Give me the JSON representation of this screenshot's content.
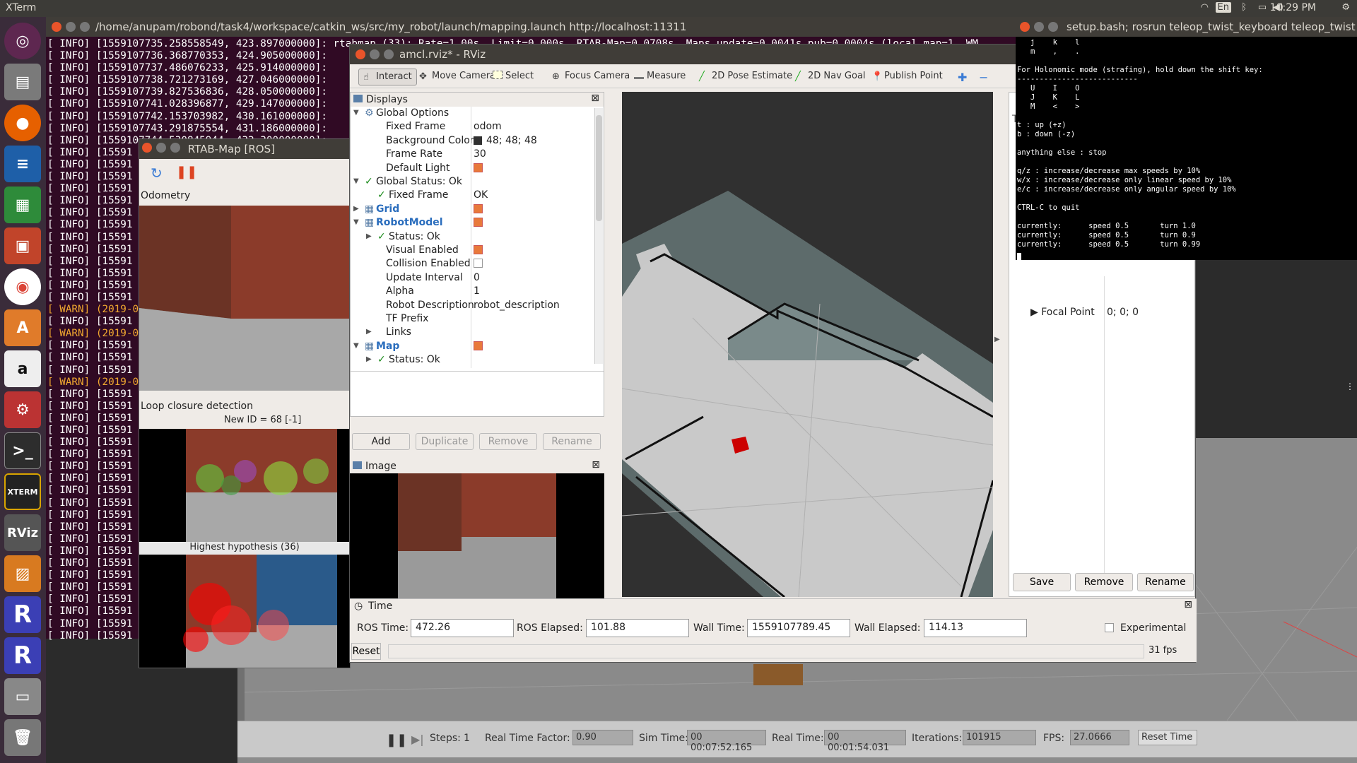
{
  "topbar": {
    "app_title": "XTerm",
    "time": "10:29 PM",
    "language": "En"
  },
  "launcher": {
    "items": [
      "ubuntu-icon",
      "files-icon",
      "firefox-icon",
      "writer-icon",
      "calc-icon",
      "impress-icon",
      "chrome-icon",
      "software-center-icon",
      "amazon-icon",
      "settings-icon",
      "terminal-icon",
      "xterm-icon",
      "rviz-icon",
      "virtualbox-icon",
      "rstudio-icon",
      "rstudio-icon-2",
      "disk-icon",
      "trash-icon"
    ]
  },
  "xterm_main": {
    "title": "/home/anupam/robond/task4/workspace/catkin_ws/src/my_robot/launch/mapping.launch http://localhost:11311",
    "lines": [
      {
        "text": "[ INFO] [1559107735.258558549, 423.897000000]: rtabmap (33): Rate=1.00s, Limit=0.000s, RTAB-Map=0.0708s, Maps update=0.0041s pub=0.0004s (local map=1, WM",
        "warn": false
      },
      {
        "text": "[ INFO] [1559107736.368770353, 424.905000000]:",
        "warn": false
      },
      {
        "text": "[ INFO] [1559107737.486076233, 425.914000000]:",
        "warn": false
      },
      {
        "text": "[ INFO] [1559107738.721273169, 427.046000000]:",
        "warn": false
      },
      {
        "text": "[ INFO] [1559107739.827536836, 428.050000000]:",
        "warn": false
      },
      {
        "text": "[ INFO] [1559107741.028396877, 429.147000000]:",
        "warn": false
      },
      {
        "text": "[ INFO] [1559107742.153703982, 430.161000000]:",
        "warn": false
      },
      {
        "text": "[ INFO] [1559107743.291875554, 431.186000000]:",
        "warn": false
      },
      {
        "text": "[ INFO] [1559107744.530845944, 432.300000000]:",
        "warn": false
      },
      {
        "text": "[ INFO] [15591",
        "warn": false
      },
      {
        "text": "[ INFO] [15591",
        "warn": false
      },
      {
        "text": "[ INFO] [15591",
        "warn": false
      },
      {
        "text": "[ INFO] [15591",
        "warn": false
      },
      {
        "text": "[ INFO] [15591",
        "warn": false
      },
      {
        "text": "[ INFO] [15591",
        "warn": false
      },
      {
        "text": "[ INFO] [15591",
        "warn": false
      },
      {
        "text": "[ INFO] [15591",
        "warn": false
      },
      {
        "text": "[ INFO] [15591",
        "warn": false
      },
      {
        "text": "[ INFO] [15591",
        "warn": false
      },
      {
        "text": "[ INFO] [15591",
        "warn": false
      },
      {
        "text": "[ INFO] [15591",
        "warn": false
      },
      {
        "text": "[ INFO] [15591",
        "warn": false
      },
      {
        "text": "[ WARN] (2019-0",
        "warn": true
      },
      {
        "text": "[ INFO] [15591",
        "warn": false
      },
      {
        "text": "[ WARN] (2019-0",
        "warn": true
      },
      {
        "text": "[ INFO] [15591",
        "warn": false
      },
      {
        "text": "[ INFO] [15591",
        "warn": false
      },
      {
        "text": "[ INFO] [15591",
        "warn": false
      },
      {
        "text": "[ WARN] (2019-0",
        "warn": true
      },
      {
        "text": "[ INFO] [15591",
        "warn": false
      },
      {
        "text": "[ INFO] [15591",
        "warn": false
      },
      {
        "text": "[ INFO] [15591",
        "warn": false
      },
      {
        "text": "[ INFO] [15591",
        "warn": false
      },
      {
        "text": "[ INFO] [15591",
        "warn": false
      },
      {
        "text": "[ INFO] [15591",
        "warn": false
      },
      {
        "text": "[ INFO] [15591",
        "warn": false
      },
      {
        "text": "[ INFO] [15591",
        "warn": false
      },
      {
        "text": "[ INFO] [15591",
        "warn": false
      },
      {
        "text": "[ INFO] [15591",
        "warn": false
      },
      {
        "text": "[ INFO] [15591",
        "warn": false
      },
      {
        "text": "[ INFO] [15591",
        "warn": false
      },
      {
        "text": "[ INFO] [15591",
        "warn": false
      },
      {
        "text": "[ INFO] [15591",
        "warn": false
      },
      {
        "text": "[ INFO] [15591",
        "warn": false
      },
      {
        "text": "[ INFO] [15591",
        "warn": false
      },
      {
        "text": "[ INFO] [15591",
        "warn": false
      },
      {
        "text": "[ INFO] [15591",
        "warn": false
      },
      {
        "text": "[ INFO] [15591",
        "warn": false
      },
      {
        "text": "[ INFO] [15591",
        "warn": false
      },
      {
        "text": "[ INFO] [15591",
        "warn": false
      }
    ]
  },
  "rtabmap": {
    "title": "RTAB-Map [ROS]",
    "odometry_label": "Odometry",
    "loop_label": "Loop closure detection",
    "new_id": "New ID = 68 [-1]",
    "hypothesis": "Highest hypothesis (36)"
  },
  "rviz": {
    "title": "amcl.rviz* - RViz",
    "tools": [
      "Interact",
      "Move Camera",
      "Select",
      "Focus Camera",
      "Measure",
      "2D Pose Estimate",
      "2D Nav Goal",
      "Publish Point"
    ],
    "displays_header": "Displays",
    "image_header": "Image",
    "time_header": "Time",
    "buttons": {
      "add": "Add",
      "duplicate": "Duplicate",
      "remove": "Remove",
      "rename": "Rename"
    },
    "views_buttons": {
      "save": "Save",
      "remove": "Remove",
      "rename": "Rename"
    },
    "views_partial": "Ty",
    "focal_point_label": "Focal Point",
    "focal_point_value": "0; 0; 0"
  },
  "tree": [
    {
      "name": "Global Options",
      "value": "",
      "indent": 0,
      "arrow": "▼",
      "kind": "globe",
      "check": null
    },
    {
      "name": "Fixed Frame",
      "value": "odom",
      "indent": 1,
      "arrow": "",
      "kind": "",
      "check": null
    },
    {
      "name": "Background Color",
      "value": "48; 48; 48",
      "indent": 1,
      "arrow": "",
      "kind": "",
      "check": null,
      "swatch": true
    },
    {
      "name": "Frame Rate",
      "value": "30",
      "indent": 1,
      "arrow": "",
      "kind": "",
      "check": null
    },
    {
      "name": "Default Light",
      "value": "",
      "indent": 1,
      "arrow": "",
      "kind": "",
      "check": true
    },
    {
      "name": "Global Status: Ok",
      "value": "",
      "indent": 0,
      "arrow": "▼",
      "kind": "ok",
      "check": null
    },
    {
      "name": "Fixed Frame",
      "value": "OK",
      "indent": 1,
      "arrow": "",
      "kind": "ok",
      "check": null
    },
    {
      "name": "Grid",
      "value": "",
      "indent": 0,
      "arrow": "▶",
      "kind": "blue",
      "check": true
    },
    {
      "name": "RobotModel",
      "value": "",
      "indent": 0,
      "arrow": "▼",
      "kind": "blue",
      "check": true
    },
    {
      "name": "Status: Ok",
      "value": "",
      "indent": 1,
      "arrow": "▶",
      "kind": "ok",
      "check": null
    },
    {
      "name": "Visual Enabled",
      "value": "",
      "indent": 1,
      "arrow": "",
      "kind": "",
      "check": true
    },
    {
      "name": "Collision Enabled",
      "value": "",
      "indent": 1,
      "arrow": "",
      "kind": "",
      "check": false
    },
    {
      "name": "Update Interval",
      "value": "0",
      "indent": 1,
      "arrow": "",
      "kind": "",
      "check": null
    },
    {
      "name": "Alpha",
      "value": "1",
      "indent": 1,
      "arrow": "",
      "kind": "",
      "check": null
    },
    {
      "name": "Robot Description",
      "value": "robot_description",
      "indent": 1,
      "arrow": "",
      "kind": "",
      "check": null
    },
    {
      "name": "TF Prefix",
      "value": "",
      "indent": 1,
      "arrow": "",
      "kind": "",
      "check": null
    },
    {
      "name": "Links",
      "value": "",
      "indent": 1,
      "arrow": "▶",
      "kind": "",
      "check": null
    },
    {
      "name": "Map",
      "value": "",
      "indent": 0,
      "arrow": "▼",
      "kind": "blue",
      "check": true
    },
    {
      "name": "Status: Ok",
      "value": "",
      "indent": 1,
      "arrow": "▶",
      "kind": "ok",
      "check": null
    }
  ],
  "time": {
    "ros_time_label": "ROS Time:",
    "ros_time": "472.26",
    "ros_elapsed_label": "ROS Elapsed:",
    "ros_elapsed": "101.88",
    "wall_time_label": "Wall Time:",
    "wall_time": "1559107789.45",
    "wall_elapsed_label": "Wall Elapsed:",
    "wall_elapsed": "114.13",
    "experimental": "Experimental",
    "reset": "Reset",
    "fps": "31 fps"
  },
  "teleop": {
    "title": "setup.bash; rosrun teleop_twist_keyboard teleop_twist",
    "lines": [
      "   j    k    l",
      "   m    ,    .",
      "",
      "For Holonomic mode (strafing), hold down the shift key:",
      "---------------------------",
      "   U    I    O",
      "   J    K    L",
      "   M    <    >",
      "",
      "t : up (+z)",
      "b : down (-z)",
      "",
      "anything else : stop",
      "",
      "q/z : increase/decrease max speeds by 10%",
      "w/x : increase/decrease only linear speed by 10%",
      "e/c : increase/decrease only angular speed by 10%",
      "",
      "CTRL-C to quit",
      "",
      "currently:      speed 0.5       turn 1.0",
      "currently:      speed 0.5       turn 0.9",
      "currently:      speed 0.5       turn 0.99"
    ]
  },
  "gazebo": {
    "steps_label": "Steps:",
    "steps": "1",
    "rtf_label": "Real Time Factor:",
    "rtf": "0.90",
    "sim_time_label": "Sim Time:",
    "sim_time": "00 00:07:52.165",
    "real_time_label": "Real Time:",
    "real_time": "00 00:01:54.031",
    "iterations_label": "Iterations:",
    "iterations": "101915",
    "fps_label": "FPS:",
    "fps": "27.0666",
    "reset_time": "Reset Time"
  }
}
